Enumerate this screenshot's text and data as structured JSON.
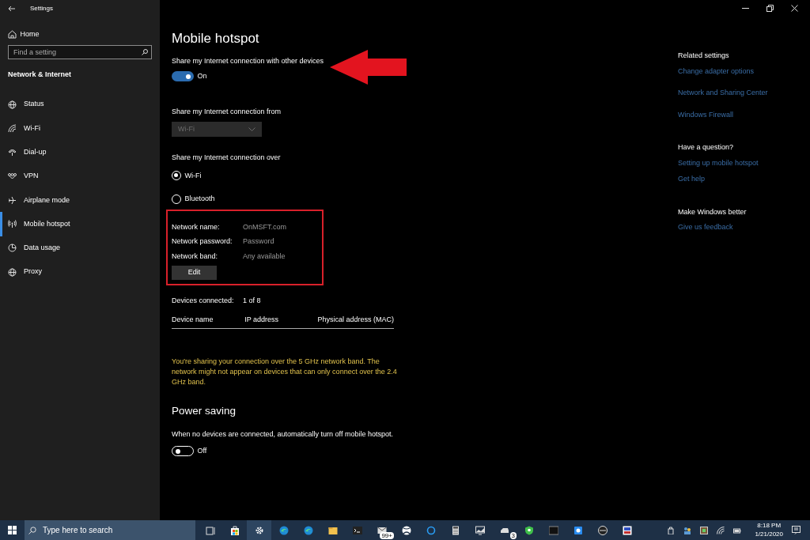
{
  "window": {
    "title": "Settings"
  },
  "sidebar": {
    "home": "Home",
    "search": {
      "placeholder": "Find a setting"
    },
    "section": "Network & Internet",
    "items": [
      {
        "label": "Status",
        "kind": "globe",
        "selected": false
      },
      {
        "label": "Wi-Fi",
        "kind": "wifi",
        "selected": false
      },
      {
        "label": "Dial-up",
        "kind": "phone",
        "selected": false
      },
      {
        "label": "VPN",
        "kind": "vpn",
        "selected": false
      },
      {
        "label": "Airplane mode",
        "kind": "plane",
        "selected": false
      },
      {
        "label": "Mobile hotspot",
        "kind": "hotspot",
        "selected": true
      },
      {
        "label": "Data usage",
        "kind": "pie",
        "selected": false
      },
      {
        "label": "Proxy",
        "kind": "globe",
        "selected": false
      }
    ]
  },
  "main": {
    "title": "Mobile hotspot",
    "share_toggle": {
      "label": "Share my Internet connection with other devices",
      "on": true,
      "state_text": "On"
    },
    "share_from": {
      "label": "Share my Internet connection from",
      "value": "Wi-Fi",
      "disabled": true
    },
    "share_over": {
      "label": "Share my Internet connection over",
      "options": [
        {
          "label": "Wi-Fi",
          "selected": true
        },
        {
          "label": "Bluetooth",
          "selected": false
        }
      ]
    },
    "network": {
      "fields": [
        {
          "label": "Network name:",
          "value": "OnMSFT.com"
        },
        {
          "label": "Network password:",
          "value": "Password"
        },
        {
          "label": "Network band:",
          "value": "Any available"
        }
      ],
      "edit_button": "Edit"
    },
    "devices": {
      "label": "Devices connected:",
      "value": "1 of 8",
      "columns": [
        "Device name",
        "IP address",
        "Physical address (MAC)"
      ]
    },
    "warning": "You're sharing your connection over the 5 GHz network band. The network might not appear on devices that can only connect over the 2.4 GHz band.",
    "power_saving": {
      "title": "Power saving",
      "description": "When no devices are connected, automatically turn off mobile hotspot.",
      "toggle": {
        "on": false,
        "state_text": "Off"
      }
    }
  },
  "related": [
    {
      "title": "Related settings",
      "links": [
        "Change adapter options",
        "Network and Sharing Center",
        "Windows Firewall"
      ]
    },
    {
      "title": "Have a question?",
      "links": [
        "Setting up mobile hotspot",
        "Get help"
      ]
    },
    {
      "title": "Make Windows better",
      "links": [
        "Give us feedback"
      ]
    }
  ],
  "taskbar": {
    "search": {
      "placeholder": "Type here to search"
    },
    "apps": [
      {
        "kind": "taskview",
        "active": false
      },
      {
        "kind": "store",
        "active": false
      },
      {
        "kind": "gear",
        "active": true
      },
      {
        "kind": "browser",
        "active": false
      },
      {
        "kind": "browser",
        "active": false
      },
      {
        "kind": "folder",
        "active": false
      },
      {
        "kind": "terminal",
        "active": false
      },
      {
        "kind": "mail",
        "active": false,
        "badge": "99+"
      },
      {
        "kind": "xbox",
        "active": false
      },
      {
        "kind": "ring",
        "active": false
      },
      {
        "kind": "calculator",
        "active": false
      },
      {
        "kind": "monitor",
        "active": false
      },
      {
        "kind": "drive",
        "active": false,
        "badge": "3"
      },
      {
        "kind": "shield",
        "active": false
      },
      {
        "kind": "window",
        "active": false
      },
      {
        "kind": "chat",
        "active": false
      },
      {
        "kind": "disc",
        "active": false
      },
      {
        "kind": "remote",
        "active": false
      }
    ],
    "tray": [
      {
        "kind": "usb"
      },
      {
        "kind": "people"
      },
      {
        "kind": "app"
      },
      {
        "kind": "wifi"
      },
      {
        "kind": "battery"
      }
    ],
    "time": "8:18 PM",
    "date": "1/21/2020"
  }
}
